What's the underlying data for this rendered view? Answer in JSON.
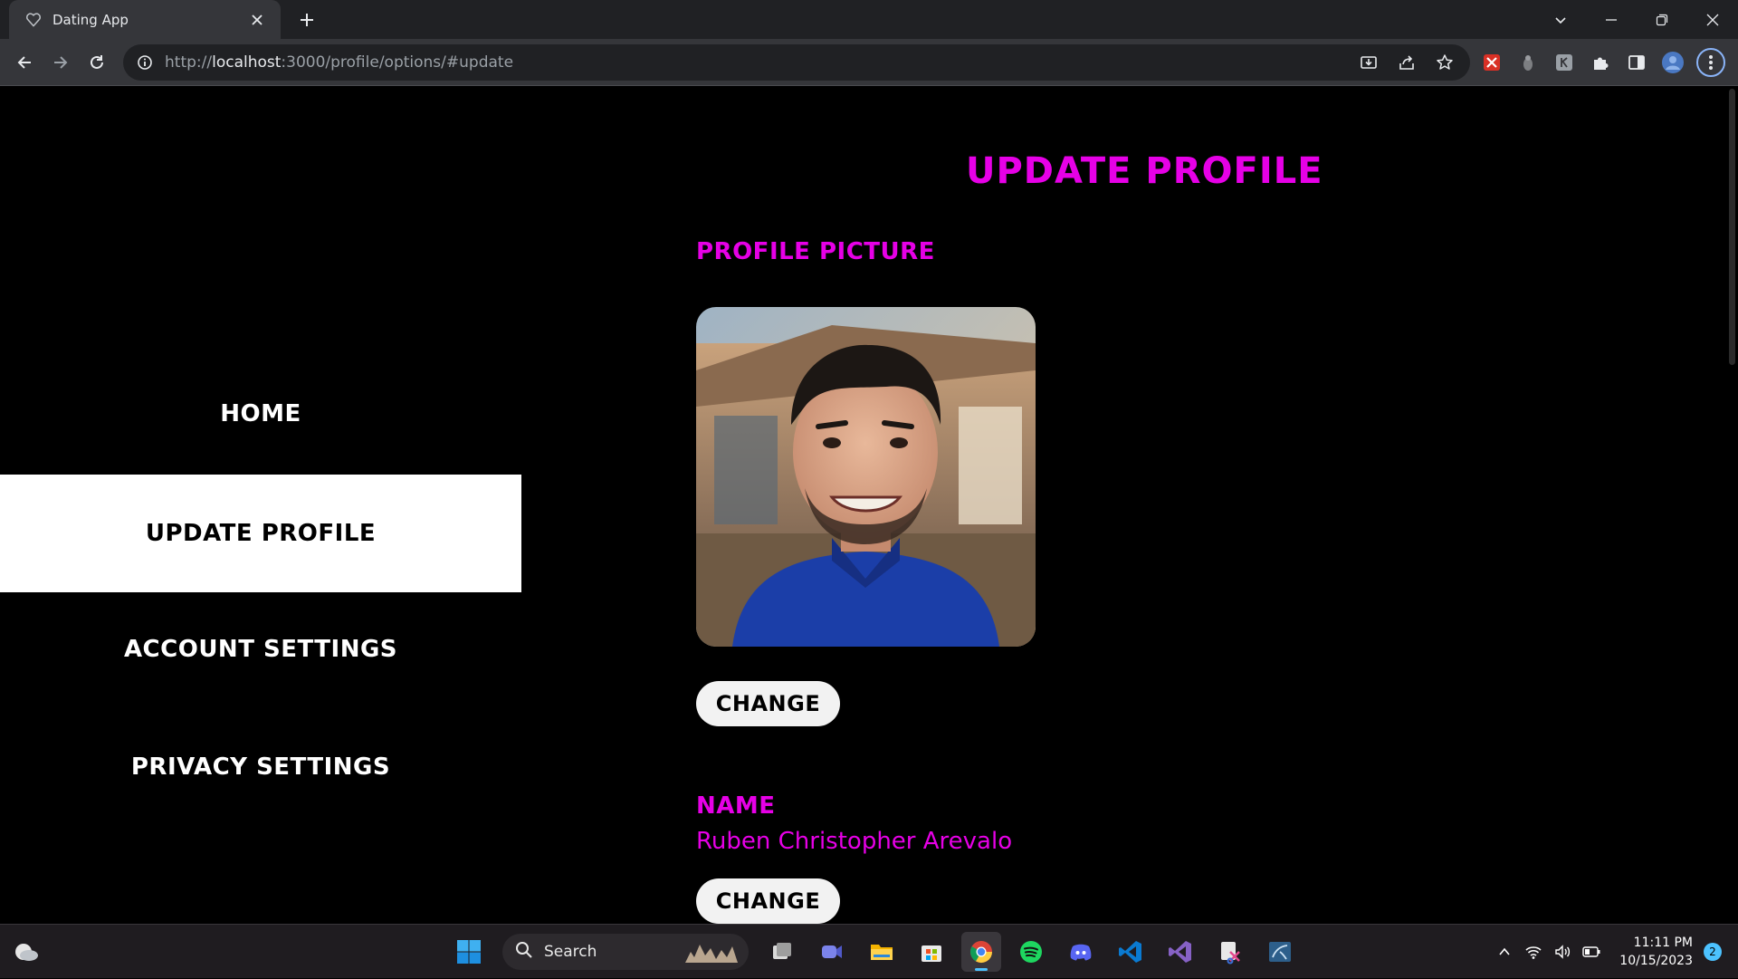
{
  "browser": {
    "tab_title": "Dating App",
    "url_prefix": "http://",
    "url_host": "localhost",
    "url_path": ":3000/profile/options/#update"
  },
  "sidebar": {
    "items": [
      {
        "label": "HOME",
        "active": false
      },
      {
        "label": "UPDATE PROFILE",
        "active": true
      },
      {
        "label": "ACCOUNT SETTINGS",
        "active": false
      },
      {
        "label": "PRIVACY SETTINGS",
        "active": false
      }
    ]
  },
  "main": {
    "title": "UPDATE PROFILE",
    "profile_picture_label": "PROFILE PICTURE",
    "change_label": "CHANGE",
    "name_label": "NAME",
    "name_value": "Ruben Christopher Arevalo"
  },
  "taskbar": {
    "search_label": "Search",
    "time": "11:11 PM",
    "date": "10/15/2023",
    "notification_count": "2"
  },
  "colors": {
    "accent": "#e600e6",
    "background": "#000000",
    "active_nav_bg": "#ffffff"
  },
  "icons": {
    "tab": "heart-outline-icon",
    "taskbar_apps": [
      "windows-start-icon",
      "task-view-icon",
      "teams-icon",
      "file-explorer-icon",
      "microsoft-store-icon",
      "chrome-icon",
      "spotify-icon",
      "discord-icon",
      "vscode-icon",
      "visual-studio-icon",
      "snipping-tool-icon",
      "mysql-workbench-icon"
    ]
  }
}
